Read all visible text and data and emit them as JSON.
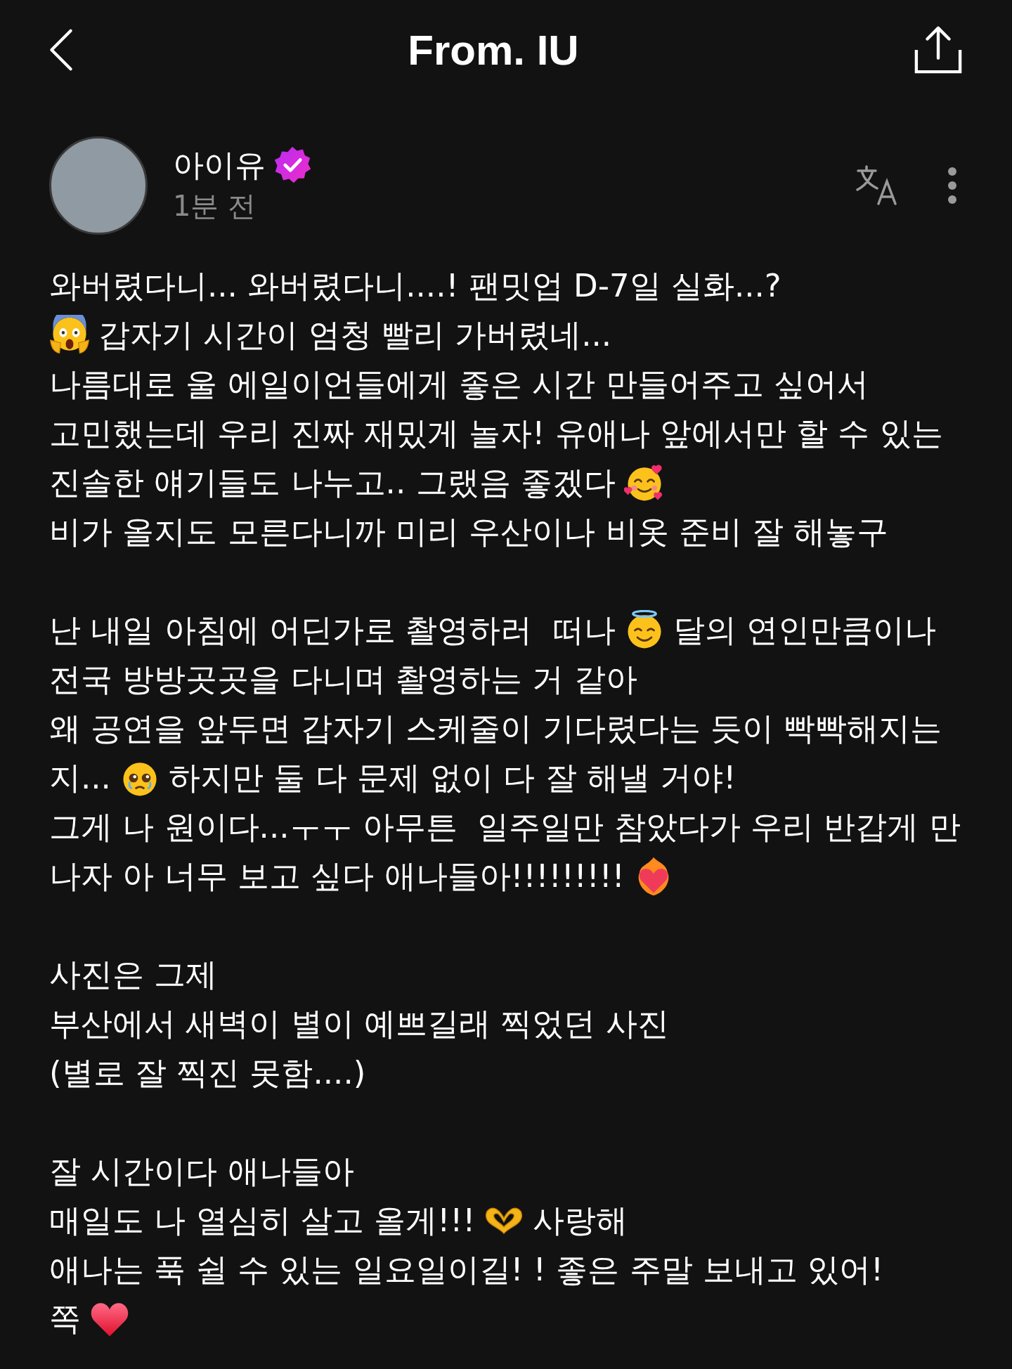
{
  "header": {
    "title": "From. IU"
  },
  "author": {
    "name": "아이유",
    "verified": true,
    "time": "1분 전"
  },
  "paragraphs": [
    [
      [
        {
          "kind": "text",
          "text": "와버렸다니... 와버렸다니....! 팬밋업 D-7일 실화...?"
        }
      ],
      [
        {
          "kind": "shocked"
        },
        {
          "kind": "text",
          "text": "갑자기 시간이 엄청 빨리 가버렸네..."
        }
      ],
      [
        {
          "kind": "text",
          "text": "나름대로 울 에일이언들에게 좋은 시간 만들어주고 싶어서"
        }
      ],
      [
        {
          "kind": "text",
          "text": "고민했는데 우리 진짜 재밌게 놀자! 유애나 앞에서만 할 수 있는"
        }
      ],
      [
        {
          "kind": "text",
          "text": "진솔한 얘기들도 나누고.. 그랬음 좋겠다"
        },
        {
          "kind": "hearts"
        }
      ],
      [
        {
          "kind": "text",
          "text": "비가 올지도 모른다니까 미리 우산이나 비옷 준비 잘 해놓구"
        }
      ]
    ],
    [
      [
        {
          "kind": "text",
          "text": "난 내일 아침에 어딘가로 촬영하러  떠나"
        },
        {
          "kind": "halo"
        },
        {
          "kind": "text",
          "text": "달의 연인만큼이나"
        }
      ],
      [
        {
          "kind": "text",
          "text": "전국 방방곳곳을 다니며 촬영하는 거 같아"
        }
      ],
      [
        {
          "kind": "text",
          "text": "왜 공연을 앞두면 갑자기 스케줄이 기다렸다는 듯이 빡빡해지는"
        }
      ],
      [
        {
          "kind": "text",
          "text": "지..."
        },
        {
          "kind": "teary"
        },
        {
          "kind": "text",
          "text": "하지만 둘 다 문제 없이 다 잘 해낼 거야!"
        }
      ],
      [
        {
          "kind": "text",
          "text": "그게 나 원이다...ㅜㅜ 아무튼  일주일만 참았다가 우리 반갑게 만"
        }
      ],
      [
        {
          "kind": "text",
          "text": "나자 아 너무 보고 싶다 애나들아!!!!!!!!!"
        },
        {
          "kind": "flameheart"
        }
      ]
    ],
    [
      [
        {
          "kind": "text",
          "text": "사진은 그제"
        }
      ],
      [
        {
          "kind": "text",
          "text": "부산에서 새벽이 별이 예쁘길래 찍었던 사진"
        }
      ],
      [
        {
          "kind": "text",
          "text": "(별로 잘 찍진 못함....)"
        }
      ]
    ],
    [
      [
        {
          "kind": "text",
          "text": "잘 시간이다 애나들아"
        }
      ],
      [
        {
          "kind": "text",
          "text": "매일도 나 열심히 살고 올게!!!"
        },
        {
          "kind": "handheart"
        },
        {
          "kind": "text",
          "text": "사랑해"
        }
      ],
      [
        {
          "kind": "text",
          "text": "애나는 푹 쉴 수 있는 일요일이길! ! 좋은 주말 보내고 있어!"
        }
      ],
      [
        {
          "kind": "text",
          "text": "쪽"
        },
        {
          "kind": "heart"
        }
      ]
    ]
  ]
}
